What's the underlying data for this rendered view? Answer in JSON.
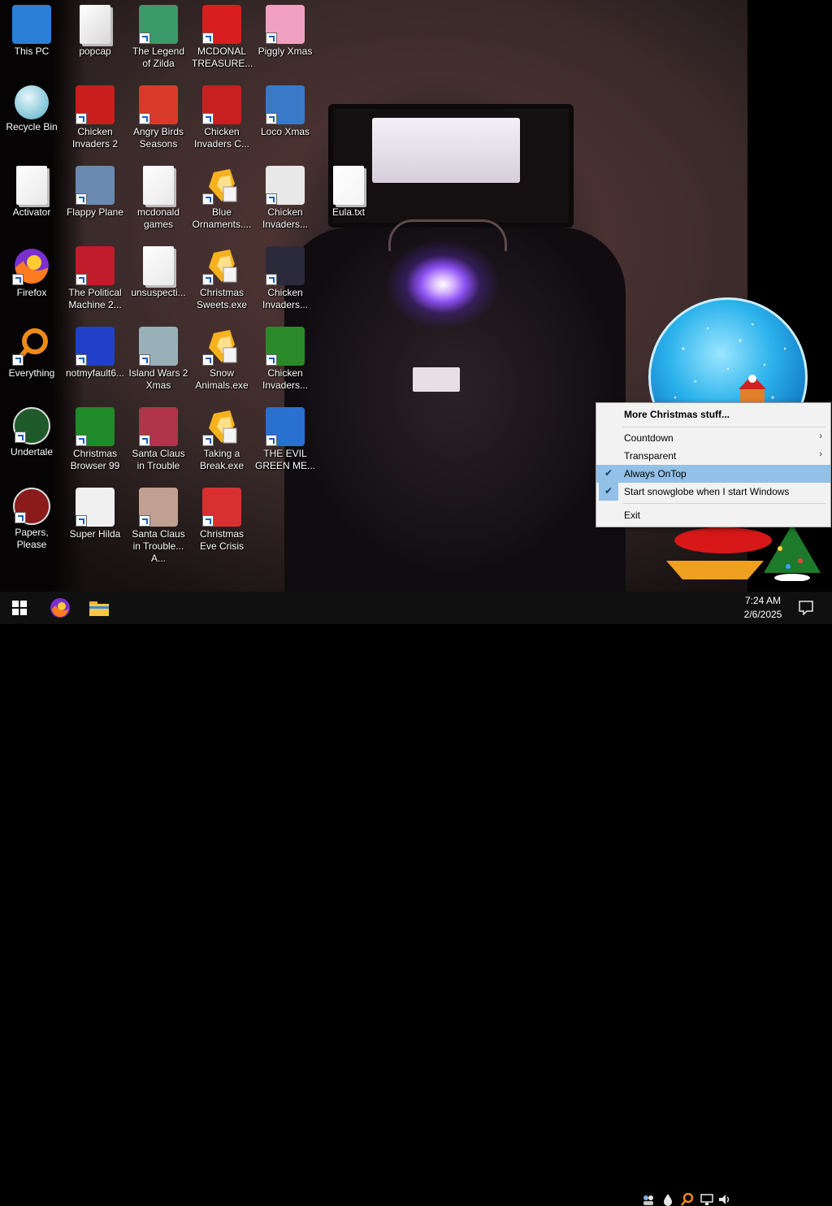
{
  "desktop": {
    "icons": [
      {
        "id": "this-pc",
        "label": "This PC",
        "icon": "computer-icon",
        "color": "#2a7fd4",
        "shortcut": false
      },
      {
        "id": "recycle-bin",
        "label": "Recycle Bin",
        "icon": "recycle-bin-icon",
        "color": "#7fc4d8",
        "shortcut": false
      },
      {
        "id": "activator",
        "label": "Activator",
        "icon": "folder-icon",
        "color": "#e8e8e8",
        "shortcut": false
      },
      {
        "id": "firefox",
        "label": "Firefox",
        "icon": "firefox-icon",
        "color": "#ff7b1f",
        "shortcut": true
      },
      {
        "id": "everything",
        "label": "Everything",
        "icon": "magnifier-icon",
        "color": "#f08a18",
        "shortcut": true
      },
      {
        "id": "undertale",
        "label": "Undertale",
        "icon": "undertale-icon",
        "color": "#1f5a2a",
        "shortcut": true
      },
      {
        "id": "papers-please",
        "label": "Papers, Please",
        "icon": "papers-please-icon",
        "color": "#8b1a1a",
        "shortcut": true
      },
      {
        "id": "popcap",
        "label": "popcap",
        "icon": "popcap-icon",
        "color": "#d8d8d8",
        "shortcut": false
      },
      {
        "id": "chicken-invaders-2",
        "label": "Chicken Invaders 2",
        "icon": "chicken-icon",
        "color": "#c81e1e",
        "shortcut": true
      },
      {
        "id": "flappy-plane",
        "label": "Flappy Plane",
        "icon": "flappy-plane-icon",
        "color": "#6a8ab0",
        "shortcut": true
      },
      {
        "id": "political-machine",
        "label": "The Political Machine 2...",
        "icon": "political-machine-icon",
        "color": "#c01c2c",
        "shortcut": true
      },
      {
        "id": "notmyfault",
        "label": "notmyfault6...",
        "icon": "bsod-icon",
        "color": "#2040c8",
        "shortcut": true
      },
      {
        "id": "christmas-browser",
        "label": "Christmas Browser 99",
        "icon": "christmas-tree-icon",
        "color": "#1f8a2a",
        "shortcut": true
      },
      {
        "id": "super-hilda",
        "label": "Super Hilda",
        "icon": "super-hilda-icon",
        "color": "#f0f0f0",
        "shortcut": true
      },
      {
        "id": "legend-of-zilda",
        "label": "The Legend of Zilda",
        "icon": "zilda-icon",
        "color": "#3a9a6a",
        "shortcut": true
      },
      {
        "id": "angry-birds",
        "label": "Angry Birds Seasons",
        "icon": "angry-birds-icon",
        "color": "#d83a2a",
        "shortcut": true
      },
      {
        "id": "mcdonald-games",
        "label": "mcdonald games",
        "icon": "folder-icon",
        "color": "#e8e8e8",
        "shortcut": false
      },
      {
        "id": "unsuspecting",
        "label": "unsuspecti...",
        "icon": "folder-icon",
        "color": "#e8e8e8",
        "shortcut": false
      },
      {
        "id": "island-wars",
        "label": "Island Wars 2 Xmas",
        "icon": "island-wars-icon",
        "color": "#9ab0b8",
        "shortcut": true
      },
      {
        "id": "santa-trouble",
        "label": "Santa Claus in Trouble",
        "icon": "santa-icon",
        "color": "#b0344a",
        "shortcut": true
      },
      {
        "id": "santa-trouble-a",
        "label": "Santa Claus in Trouble... A...",
        "icon": "santa-icon",
        "color": "#c0a090",
        "shortcut": true
      },
      {
        "id": "mcdonald-treasure",
        "label": "MCDONAL TREASURE...",
        "icon": "mcdonalds-icon",
        "color": "#d81e1e",
        "shortcut": true
      },
      {
        "id": "chicken-invaders-c",
        "label": "Chicken Invaders C...",
        "icon": "snowman-chicken-icon",
        "color": "#c82020",
        "shortcut": true
      },
      {
        "id": "blue-ornaments",
        "label": "Blue Ornaments....",
        "icon": "ornament-exe-icon",
        "color": "#f0a020",
        "shortcut": true
      },
      {
        "id": "christmas-sweets",
        "label": "Christmas Sweets.exe",
        "icon": "ornament-exe-icon",
        "color": "#f0a020",
        "shortcut": true
      },
      {
        "id": "snow-animals",
        "label": "Snow Animals.exe",
        "icon": "ornament-exe-icon",
        "color": "#f0a020",
        "shortcut": true
      },
      {
        "id": "taking-a-break",
        "label": "Taking a Break.exe",
        "icon": "ornament-exe-icon",
        "color": "#f0a020",
        "shortcut": true
      },
      {
        "id": "christmas-eve-crisis",
        "label": "Christmas Eve Crisis",
        "icon": "santa-icon",
        "color": "#d83030",
        "shortcut": true
      },
      {
        "id": "piggly-xmas",
        "label": "Piggly Xmas",
        "icon": "pig-icon",
        "color": "#f0a0c0",
        "shortcut": true
      },
      {
        "id": "loco-xmas",
        "label": "Loco Xmas",
        "icon": "bear-icon",
        "color": "#3a78c8",
        "shortcut": true
      },
      {
        "id": "chicken-invaders-3",
        "label": "Chicken Invaders...",
        "icon": "chicken-icon",
        "color": "#e8e8e8",
        "shortcut": true
      },
      {
        "id": "chicken-invaders-4",
        "label": "Chicken Invaders...",
        "icon": "chicken-icon",
        "color": "#2a2a3a",
        "shortcut": true
      },
      {
        "id": "chicken-invaders-5",
        "label": "Chicken Invaders...",
        "icon": "chicken-icon",
        "color": "#2a8a2a",
        "shortcut": true
      },
      {
        "id": "evil-green",
        "label": "THE EVIL GREEN ME...",
        "icon": "messenger-icon",
        "color": "#2a70d0",
        "shortcut": true
      },
      {
        "id": "eula",
        "label": "Eula.txt",
        "icon": "text-file-icon",
        "color": "#f4f4f4",
        "shortcut": false
      }
    ]
  },
  "context_menu": {
    "items": [
      {
        "label": "More Christmas stuff...",
        "bold": true,
        "checked": false,
        "submenu": false
      },
      {
        "label": "Countdown",
        "bold": false,
        "checked": false,
        "submenu": true
      },
      {
        "label": "Transparent",
        "bold": false,
        "checked": false,
        "submenu": true
      },
      {
        "label": "Always OnTop",
        "bold": false,
        "checked": true,
        "submenu": false,
        "highlighted": true
      },
      {
        "label": "Start snowglobe when I start Windows",
        "bold": false,
        "checked": true,
        "submenu": false
      },
      {
        "label": "Exit",
        "bold": false,
        "checked": false,
        "submenu": false
      }
    ],
    "check_glyph": "✔",
    "submenu_glyph": "›"
  },
  "taskbar": {
    "start_icon": "windows-start-icon",
    "pinned": [
      "firefox-icon",
      "file-explorer-icon"
    ],
    "tray_icons": [
      "people-icon",
      "drop-icon",
      "everything-search-icon",
      "network-icon",
      "volume-icon"
    ],
    "clock_time": "7:24 AM",
    "clock_date": "2/6/2025",
    "notification_icon": "action-center-icon"
  },
  "colors": {
    "taskbar": "#101010",
    "menu_bg": "#f2f2f2",
    "menu_highlight": "#92c0e6",
    "label_text": "#ffffff"
  }
}
